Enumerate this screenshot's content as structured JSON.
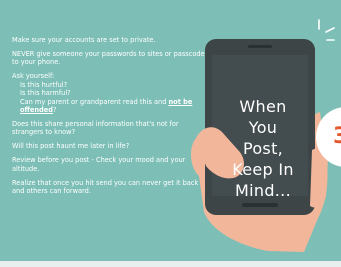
{
  "tips": {
    "p1": "Make sure your accounts are set to private.",
    "p2": "NEVER give someone your passwords to sites or passcode to your phone.",
    "ask_heading": "Ask yourself:",
    "q1": "Is this hurtful?",
    "q2": "Is this harmful?",
    "q3_prefix": "Can my parent or grandparent read this and ",
    "q3_emphasis": "not be offended",
    "q3_suffix": "?",
    "p4": "Does this share personal information that's not for strangers to know?",
    "p5": "Will this post haunt me later in life?",
    "p6": "Review before you post - Check your mood and your altitude.",
    "p7": "Realize that once you hit send you can never get it back and others can forward."
  },
  "phone_screen": {
    "line1": "When",
    "line2": "You",
    "line3": "Post,",
    "line4": "Keep In",
    "line5": "Mind..."
  },
  "side_circle_glyph": "3",
  "colors": {
    "background": "#7dbfb6",
    "phone_body": "#3d4547",
    "phone_screen": "#434c4e",
    "hand": "#f2b79b",
    "accent": "#e4572e"
  }
}
